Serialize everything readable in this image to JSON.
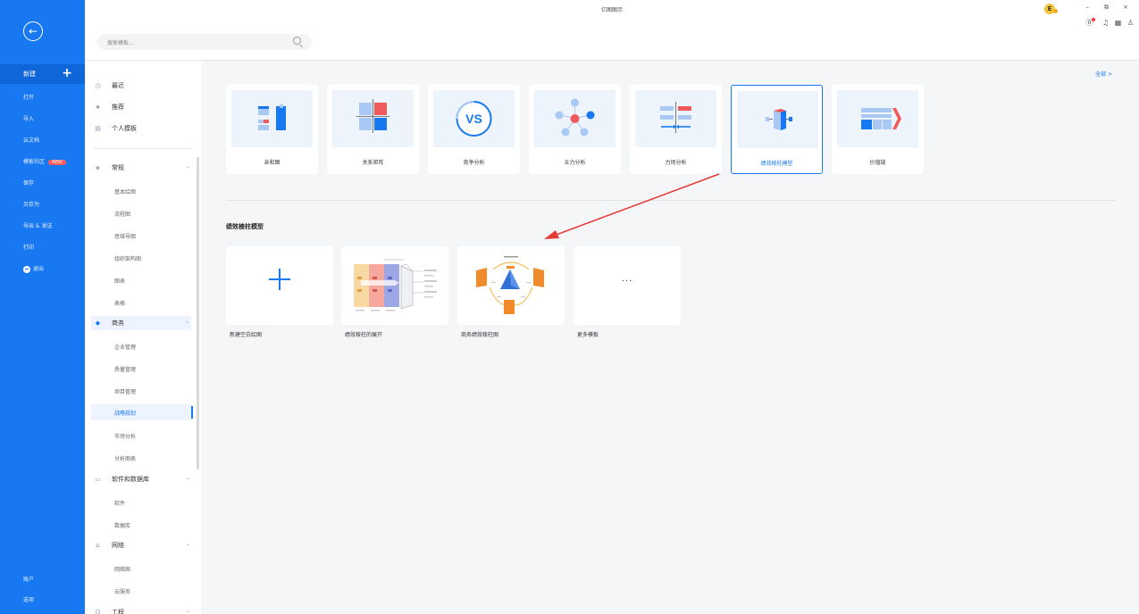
{
  "window": {
    "title": "亿图图示",
    "avatar_letter": "E",
    "minimize": "–",
    "restore": "⧉",
    "close": "×"
  },
  "sidebar": {
    "back_icon": "←",
    "new_label": "新建",
    "new_plus": "+",
    "items": [
      {
        "label": "打开"
      },
      {
        "label": "导入"
      },
      {
        "label": "云文档"
      },
      {
        "label": "模板社区",
        "badge": "NEW"
      },
      {
        "label": "保存"
      },
      {
        "label": "另存为"
      },
      {
        "label": "导出 & 发送"
      },
      {
        "label": "打印"
      },
      {
        "label": "退出"
      }
    ],
    "bottom": [
      {
        "label": "账户"
      },
      {
        "label": "选项"
      }
    ]
  },
  "search": {
    "placeholder": "搜索模板..."
  },
  "categories": {
    "top": [
      {
        "label": "最近",
        "icon": "clock-icon"
      },
      {
        "label": "推荐",
        "icon": "star-icon"
      },
      {
        "label": "个人模板",
        "icon": "user-template-icon"
      }
    ],
    "groups": [
      {
        "label": "常规",
        "icon": "general-icon"
      },
      {
        "label": "商务",
        "icon": "business-icon"
      },
      {
        "label": "软件和数据库",
        "icon": "software-icon"
      },
      {
        "label": "网络",
        "icon": "network-icon"
      },
      {
        "label": "工程",
        "icon": "engineering-icon"
      }
    ],
    "general_subs": [
      "基本绘图",
      "流程图",
      "思维导图",
      "组织架构图",
      "图表",
      "表格"
    ],
    "business_subs": [
      "企业管理",
      "质量管理",
      "项目管理",
      "战略规划",
      "市场分析",
      "分析图表"
    ],
    "software_subs": [
      "软件",
      "数据库"
    ],
    "network_subs": [
      "网络图",
      "云服务"
    ],
    "active_sub": "战略规划",
    "chevron": "⌄"
  },
  "main": {
    "all_link": "全部 >",
    "top_cards": [
      {
        "label": "亲和图"
      },
      {
        "label": "关系矩阵"
      },
      {
        "label": "竞争分析",
        "thumb_text": "VS"
      },
      {
        "label": "五力分析"
      },
      {
        "label": "力场分析"
      },
      {
        "label": "绩效棱柱模型"
      },
      {
        "label": "价值链"
      }
    ],
    "section_title": "绩效棱柱模型",
    "template_cards": [
      {
        "label": "新建空白绘图"
      },
      {
        "label": "绩效棱柱的展开"
      },
      {
        "label": "商务绩效棱柱图"
      },
      {
        "label": "更多模板",
        "dots": "···"
      }
    ]
  },
  "colors": {
    "accent": "#1778f2",
    "sidebar": "#1778f2",
    "arrow": "#e53935",
    "badge": "#ff5a5a"
  }
}
